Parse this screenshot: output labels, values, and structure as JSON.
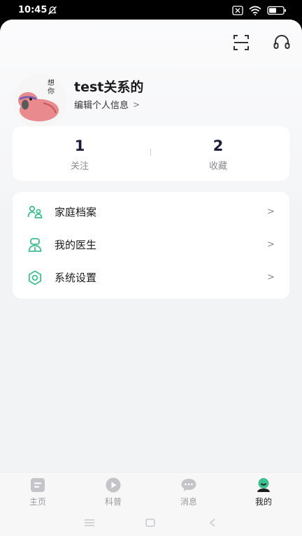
{
  "status_bar": {
    "time": "10:45"
  },
  "header": {
    "scan_icon": "scan-icon",
    "service_icon": "headset-icon"
  },
  "profile": {
    "name": "test关系的",
    "edit_label": "编辑个人信息",
    "avatar_text": "想你"
  },
  "stats": [
    {
      "value": "1",
      "label": "关注"
    },
    {
      "value": "2",
      "label": "收藏"
    }
  ],
  "menu": [
    {
      "label": "家庭档案",
      "icon": "family-icon"
    },
    {
      "label": "我的医生",
      "icon": "doctor-icon"
    },
    {
      "label": "系统设置",
      "icon": "settings-icon"
    }
  ],
  "bottom_nav": [
    {
      "label": "主页",
      "icon": "home-icon",
      "active": false
    },
    {
      "label": "科普",
      "icon": "play-icon",
      "active": false
    },
    {
      "label": "消息",
      "icon": "chat-icon",
      "active": false
    },
    {
      "label": "我的",
      "icon": "profile-icon",
      "active": true
    }
  ],
  "colors": {
    "accent": "#3dbf8f",
    "inactive": "#c4c4c9",
    "text": "#1c1c1e"
  }
}
